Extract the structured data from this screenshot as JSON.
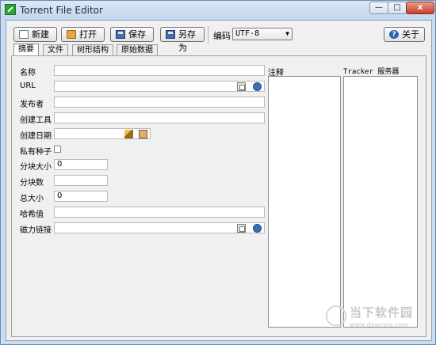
{
  "window": {
    "title": "Torrent File Editor",
    "controls": {
      "close": "x"
    }
  },
  "toolbar": {
    "new_label": "新建",
    "open_label": "打开",
    "save_label": "保存",
    "save_as_label": "另存为",
    "encoding_label": "编码",
    "encoding_value": "UTF-8",
    "about_label": "关于"
  },
  "tabs": [
    {
      "label": "摘要",
      "active": true
    },
    {
      "label": "文件",
      "active": false
    },
    {
      "label": "树形结构",
      "active": false
    },
    {
      "label": "原始数据",
      "active": false
    }
  ],
  "summary": {
    "name_label": "名称",
    "url_label": "URL",
    "publisher_label": "发布者",
    "created_by_label": "创建工具",
    "creation_date_label": "创建日期",
    "private_label": "私有种子",
    "private_checked": false,
    "piece_size_label": "分块大小",
    "piece_size_value": "0",
    "piece_count_label": "分块数",
    "piece_count_value": "",
    "total_size_label": "总大小",
    "total_size_value": "0",
    "hash_label": "哈希值",
    "magnet_label": "磁力链接",
    "comment_label": "注释",
    "trackers_label": "Tracker 服务器"
  },
  "watermark": {
    "text": "当下软件园",
    "url": "www.downxia.com"
  }
}
